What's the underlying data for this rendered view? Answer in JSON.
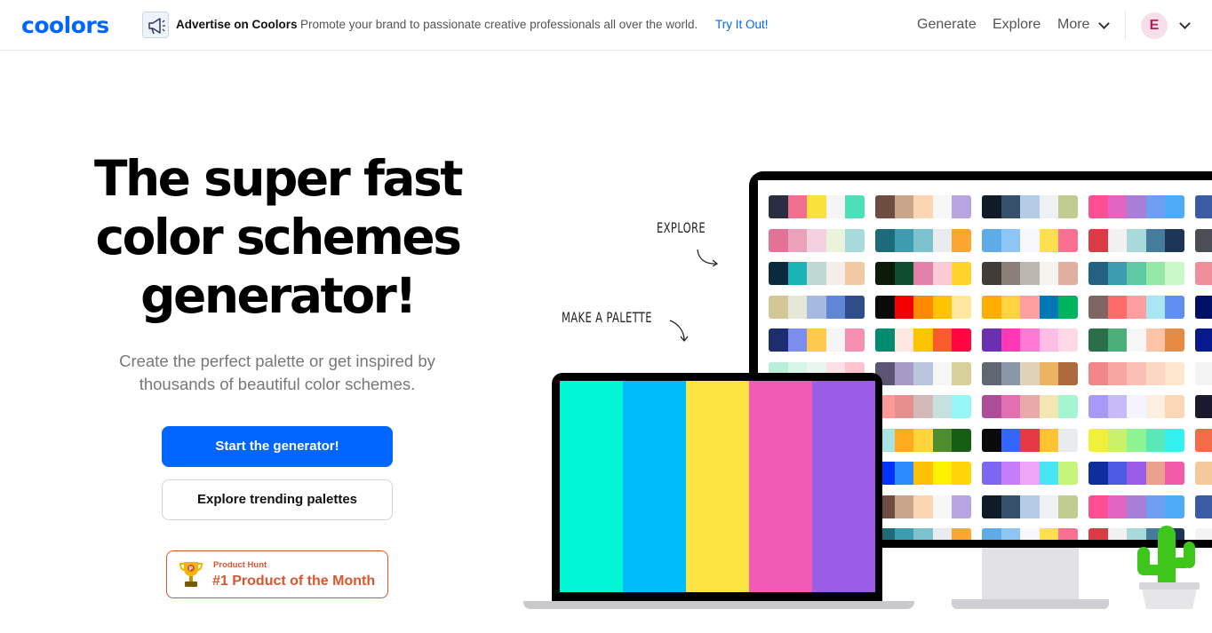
{
  "header": {
    "logo": "coolors",
    "ad_title": "Advertise on Coolors",
    "ad_description": "Promote your brand to passionate creative professionals all over the world.",
    "ad_link": "Try It Out!",
    "nav": {
      "generate": "Generate",
      "explore": "Explore",
      "more": "More"
    },
    "avatar_initial": "E"
  },
  "hero": {
    "title_line1": "The super fast",
    "title_line2": "color schemes",
    "title_line3": "generator!",
    "subtitle_line1": "Create the perfect palette or get inspired by",
    "subtitle_line2": "thousands of beautiful color schemes.",
    "primary_button": "Start the generator!",
    "secondary_button": "Explore trending palettes",
    "badge_small": "Product Hunt",
    "badge_big": "#1 Product of the Month"
  },
  "illustration": {
    "annotation_explore": "EXPLORE",
    "annotation_make": "MAKE A PALETTE",
    "laptop_palette": [
      "#00f5d4",
      "#00bbf9",
      "#fee440",
      "#f15bb5",
      "#9b5de5"
    ],
    "monitor_palettes": [
      [
        [
          "#2b2d42",
          "#ef6f8f",
          "#f9e13b",
          "#f5f5f5",
          "#4de0b8"
        ],
        [
          "#6d4c41",
          "#c9a58a",
          "#fcd5b5",
          "#f7f7f7",
          "#b9a4e2"
        ],
        [
          "#0f1b26",
          "#364f6b",
          "#b5cce6",
          "#eef1f4",
          "#c1cc90"
        ],
        [
          "#ff4e91",
          "#e066c2",
          "#a77fd9",
          "#6f9ff0",
          "#4dabf7"
        ]
      ],
      [
        [
          "#e27396",
          "#eaa1b9",
          "#f3d1e0",
          "#eaf4dd",
          "#a8dadc"
        ],
        [
          "#1d6a7a",
          "#3d9db0",
          "#7cc2cc",
          "#e9ecef",
          "#fca630"
        ],
        [
          "#5eabea",
          "#8dc6f5",
          "#f6f8fb",
          "#fddf4f",
          "#fb6f92"
        ],
        [
          "#dc3b45",
          "#f1f1f1",
          "#a8dadc",
          "#457b9d",
          "#1d3557"
        ]
      ],
      [
        [
          "#0c2a3d",
          "#1ab3b7",
          "#bfd8d3",
          "#f3eee9",
          "#f1caa5"
        ],
        [
          "#0c1a09",
          "#0e4d30",
          "#e180a9",
          "#fccad7",
          "#ffd32a"
        ],
        [
          "#413c38",
          "#8a7f79",
          "#bcb8b1",
          "#f4f3ee",
          "#e0afa0"
        ],
        [
          "#246182",
          "#3b9cae",
          "#5fc8a4",
          "#95e8a8",
          "#c9f9c8"
        ]
      ],
      [
        [
          "#d4c796",
          "#e5e7d8",
          "#a6b9de",
          "#5f87d6",
          "#2e4d8a"
        ],
        [
          "#0a0a0a",
          "#f40000",
          "#ff8a00",
          "#ffc300",
          "#ffe89e"
        ],
        [
          "#ffae00",
          "#ffd23f",
          "#ff9f9f",
          "#0077b6",
          "#00b35f"
        ],
        [
          "#7e6665",
          "#ff6b6b",
          "#ff9e9e",
          "#a8e6f4",
          "#5f8ff0"
        ]
      ],
      [
        [
          "#1e2d70",
          "#7b8ef0",
          "#ffc94d",
          "#f5f5f5",
          "#f78fb0"
        ],
        [
          "#008c6f",
          "#fde7e0",
          "#fdc500",
          "#f95d2b",
          "#ff0541"
        ],
        [
          "#6b2fb2",
          "#ff38b8",
          "#ff79d5",
          "#ffbde6",
          "#ffd9e6"
        ],
        [
          "#2a6f4a",
          "#4caf7a",
          "#f6f6f6",
          "#ffc4a8",
          "#e68b44"
        ]
      ],
      [
        [
          "#b7efd8",
          "#d7f5e6",
          "#e9f5ef",
          "#fbe0e6",
          "#ffc2cf"
        ],
        [
          "#5b5473",
          "#a79bc6",
          "#b9c6dd",
          "#f6f6f6",
          "#d8d09a"
        ],
        [
          "#5f6872",
          "#8a97a8",
          "#e0d2b8",
          "#ebb464",
          "#ad6a3d"
        ],
        [
          "#f2868a",
          "#f8a6a2",
          "#fac0b8",
          "#fcd8c4",
          "#fee7cf"
        ]
      ],
      [
        [
          "#ff9999",
          "#e58e8e",
          "#d3b9b9",
          "#c6e0e0",
          "#97f6f6"
        ],
        [
          "#ad4d9a",
          "#e070b0",
          "#e9a9a9",
          "#f2e6b3",
          "#a5f5d2"
        ],
        [
          "#a999f6",
          "#c6baf8",
          "#f4f4ff",
          "#fdf0e2",
          "#fcd7b5"
        ]
      ],
      [
        [
          "#a8e3e3",
          "#ffab1f",
          "#ffd43b",
          "#4e8c2e",
          "#155e14"
        ],
        [
          "#0a0a0a",
          "#3366ff",
          "#e63946",
          "#ffc233",
          "#e9ecef"
        ],
        [
          "#f0f03c",
          "#c9f26a",
          "#8ef493",
          "#5be8b8",
          "#33f0f0"
        ]
      ],
      [
        [
          "#0033ff",
          "#2c8cff",
          "#ffc107",
          "#fff200",
          "#ffd60a"
        ],
        [
          "#7d66f0",
          "#c77df9",
          "#f0a6f7",
          "#48e6f5",
          "#c7f47a"
        ],
        [
          "#0f2e9e",
          "#4d5ce2",
          "#9b5ce8",
          "#eaa08e",
          "#f25ba7"
        ]
      ],
      [
        [
          "#6d4c41",
          "#c9a58a",
          "#fcd5b5",
          "#f7f7f7",
          "#b9a4e2"
        ],
        [
          "#0f1b26",
          "#364f6b",
          "#b5cce6",
          "#eef1f4",
          "#c1cc90"
        ],
        [
          "#ff4e91",
          "#e066c2",
          "#a77fd9",
          "#6f9ff0",
          "#4dabf7"
        ]
      ],
      [
        [
          "#1d6a7a",
          "#3d9db0",
          "#7cc2cc",
          "#e9ecef",
          "#fca630"
        ],
        [
          "#5eabea",
          "#8dc6f5",
          "#f6f8fb",
          "#fddf4f",
          "#fb6f92"
        ],
        [
          "#dc3b45",
          "#f1f1f1",
          "#a8dadc",
          "#457b9d",
          "#1d3557"
        ]
      ]
    ],
    "edge_colors": [
      "#3b5ba5",
      "#4b4e57",
      "#f08f9b",
      "#001066",
      "#061a90",
      "#f4f4f4",
      "#1a1a2e",
      "#f36b47",
      "#f5c99a",
      "#3b5ba5",
      "#f4f4f4"
    ]
  }
}
